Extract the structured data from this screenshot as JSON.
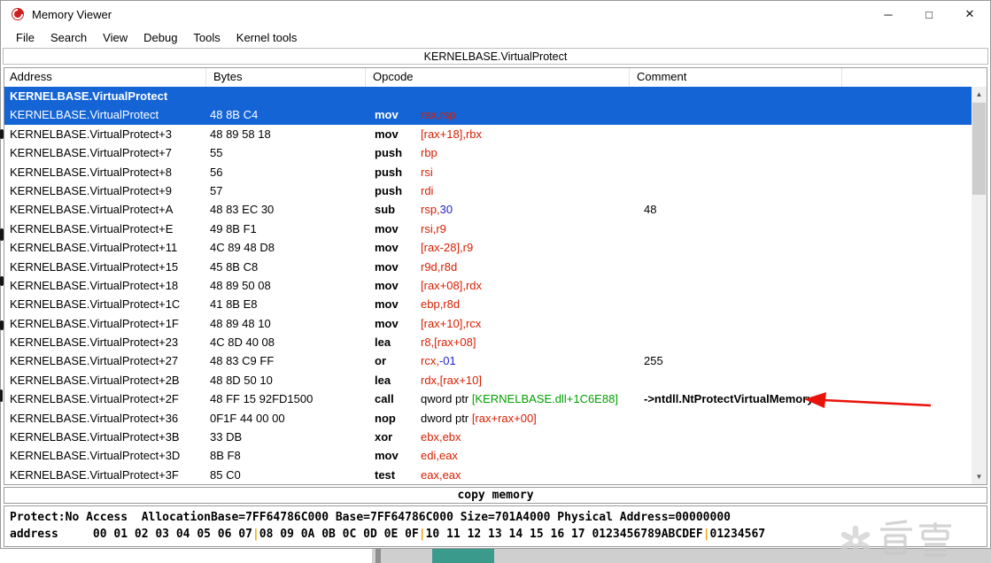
{
  "window": {
    "title": "Memory Viewer"
  },
  "icons": {
    "minimize": "─",
    "maximize": "□",
    "close": "✕",
    "scroll_up": "▲",
    "scroll_down": "▼"
  },
  "menu": {
    "items": [
      "File",
      "Search",
      "View",
      "Debug",
      "Tools",
      "Kernel tools"
    ]
  },
  "caption": "KERNELBASE.VirtualProtect",
  "table": {
    "columns": [
      "Address",
      "Bytes",
      "Opcode",
      "Comment"
    ],
    "rows": [
      {
        "section": true,
        "sel": true,
        "label": "KERNELBASE.VirtualProtect"
      },
      {
        "sel": true,
        "addr": "KERNELBASE.VirtualProtect",
        "bytes": "48 8B C4",
        "mn": "mov",
        "ops": [
          {
            "t": "rax,rsp",
            "c": "r"
          }
        ],
        "cmt": ""
      },
      {
        "addr": "KERNELBASE.VirtualProtect+3",
        "bytes": "48 89 58 18",
        "mn": "mov",
        "ops": [
          {
            "t": "[rax+18],rbx",
            "c": "r"
          }
        ],
        "cmt": ""
      },
      {
        "addr": "KERNELBASE.VirtualProtect+7",
        "bytes": "55",
        "mn": "push",
        "ops": [
          {
            "t": "rbp",
            "c": "r"
          }
        ],
        "cmt": ""
      },
      {
        "addr": "KERNELBASE.VirtualProtect+8",
        "bytes": "56",
        "mn": "push",
        "ops": [
          {
            "t": "rsi",
            "c": "r"
          }
        ],
        "cmt": ""
      },
      {
        "addr": "KERNELBASE.VirtualProtect+9",
        "bytes": "57",
        "mn": "push",
        "ops": [
          {
            "t": "rdi",
            "c": "r"
          }
        ],
        "cmt": ""
      },
      {
        "addr": "KERNELBASE.VirtualProtect+A",
        "bytes": "48 83 EC 30",
        "mn": "sub",
        "ops": [
          {
            "t": "rsp,",
            "c": "r"
          },
          {
            "t": "30",
            "c": "b"
          }
        ],
        "cmt": "48"
      },
      {
        "addr": "KERNELBASE.VirtualProtect+E",
        "bytes": "49 8B F1",
        "mn": "mov",
        "ops": [
          {
            "t": "rsi,r9",
            "c": "r"
          }
        ],
        "cmt": ""
      },
      {
        "addr": "KERNELBASE.VirtualProtect+11",
        "bytes": "4C 89 48 D8",
        "mn": "mov",
        "ops": [
          {
            "t": "[rax-28],r9",
            "c": "r"
          }
        ],
        "cmt": ""
      },
      {
        "addr": "KERNELBASE.VirtualProtect+15",
        "bytes": "45 8B C8",
        "mn": "mov",
        "ops": [
          {
            "t": "r9d,r8d",
            "c": "r"
          }
        ],
        "cmt": ""
      },
      {
        "addr": "KERNELBASE.VirtualProtect+18",
        "bytes": "48 89 50 08",
        "mn": "mov",
        "ops": [
          {
            "t": "[rax+08],rdx",
            "c": "r"
          }
        ],
        "cmt": ""
      },
      {
        "addr": "KERNELBASE.VirtualProtect+1C",
        "bytes": "41 8B E8",
        "mn": "mov",
        "ops": [
          {
            "t": "ebp,r8d",
            "c": "r"
          }
        ],
        "cmt": ""
      },
      {
        "addr": "KERNELBASE.VirtualProtect+1F",
        "bytes": "48 89 48 10",
        "mn": "mov",
        "ops": [
          {
            "t": "[rax+10],rcx",
            "c": "r"
          }
        ],
        "cmt": ""
      },
      {
        "addr": "KERNELBASE.VirtualProtect+23",
        "bytes": "4C 8D 40 08",
        "mn": "lea",
        "ops": [
          {
            "t": "r8,[rax+08]",
            "c": "r"
          }
        ],
        "cmt": ""
      },
      {
        "addr": "KERNELBASE.VirtualProtect+27",
        "bytes": "48 83 C9 FF",
        "mn": "or",
        "ops": [
          {
            "t": "rcx,",
            "c": "r"
          },
          {
            "t": "-01",
            "c": "b"
          }
        ],
        "cmt": "255"
      },
      {
        "addr": "KERNELBASE.VirtualProtect+2B",
        "bytes": "48 8D 50 10",
        "mn": "lea",
        "ops": [
          {
            "t": "rdx,[rax+10]",
            "c": "r"
          }
        ],
        "cmt": ""
      },
      {
        "addr": "KERNELBASE.VirtualProtect+2F",
        "bytes": "48 FF 15 92FD1500",
        "mn": "call",
        "ops": [
          {
            "t": "qword ptr ",
            "c": "k"
          },
          {
            "t": "[KERNELBASE.dll+1C6E88]",
            "c": "g"
          }
        ],
        "cmt": "->ntdll.NtProtectVirtualMemory",
        "cmt_bold": true
      },
      {
        "addr": "KERNELBASE.VirtualProtect+36",
        "bytes": "0F1F 44 00 00",
        "mn": "nop",
        "ops": [
          {
            "t": "dword ptr ",
            "c": "k"
          },
          {
            "t": "[rax+rax+00]",
            "c": "r"
          }
        ],
        "cmt": ""
      },
      {
        "addr": "KERNELBASE.VirtualProtect+3B",
        "bytes": "33 DB",
        "mn": "xor",
        "ops": [
          {
            "t": "ebx,ebx",
            "c": "r"
          }
        ],
        "cmt": ""
      },
      {
        "addr": "KERNELBASE.VirtualProtect+3D",
        "bytes": "8B F8",
        "mn": "mov",
        "ops": [
          {
            "t": "edi,eax",
            "c": "r"
          }
        ],
        "cmt": ""
      },
      {
        "addr": "KERNELBASE.VirtualProtect+3F",
        "bytes": "85 C0",
        "mn": "test",
        "ops": [
          {
            "t": "eax,eax",
            "c": "r"
          }
        ],
        "cmt": ""
      }
    ]
  },
  "copy_bar": "copy memory",
  "status": {
    "line1": "Protect:No Access  AllocationBase=7FF64786C000 Base=7FF64786C000 Size=701A4000 Physical Address=00000000",
    "line2_segments": [
      {
        "t": "address     00 01 02 03 04 05 06 07",
        "c": "k"
      },
      {
        "t": "|",
        "c": "o"
      },
      {
        "t": "08 09 0A 0B 0C 0D 0E 0F",
        "c": "k"
      },
      {
        "t": "|",
        "c": "o"
      },
      {
        "t": "10 11 12 13 14 15 16 17 0123456789ABCDEF",
        "c": "k"
      },
      {
        "t": "|",
        "c": "o"
      },
      {
        "t": "01234567",
        "c": "k"
      }
    ]
  },
  "watermark": "看雪",
  "colors": {
    "selection": "#1464d6",
    "operand_red": "#d81e00",
    "operand_blue": "#1f1fd0",
    "module_green": "#00a000",
    "separator_orange": "#efa400",
    "annotation_red": "#e8140c"
  }
}
